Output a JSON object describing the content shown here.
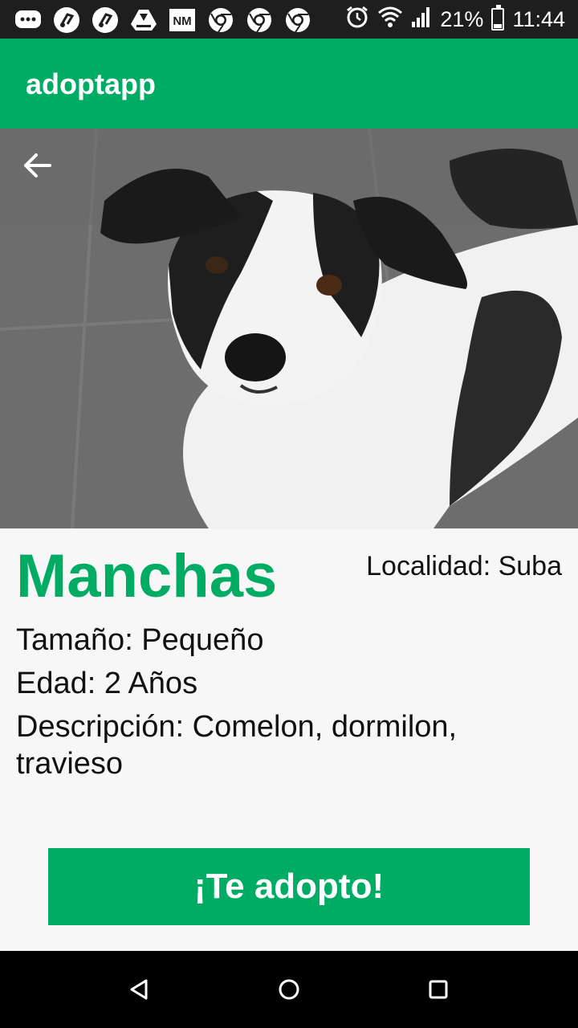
{
  "status_bar": {
    "icons": [
      "message-icon",
      "music-app-icon",
      "music-app-icon",
      "drive-icon",
      "nm-icon",
      "chrome-icon",
      "chrome-icon",
      "chrome-icon"
    ],
    "nm_text": "NM",
    "battery_percent": "21%",
    "battery_level": 0.21,
    "time": "11:44"
  },
  "app_bar": {
    "title": "adoptapp"
  },
  "pet": {
    "name": "Manchas",
    "location": "Localidad: Suba",
    "size": "Tamaño: Pequeño",
    "age": "Edad: 2 Años",
    "description": "Descripción: Comelon, dormilon, travieso"
  },
  "actions": {
    "adopt_label": "¡Te adopto!"
  },
  "colors": {
    "primary": "#00ab63",
    "status_bar": "#1e1e1e",
    "nav_bar": "#000000",
    "background": "#f7f7f7"
  }
}
